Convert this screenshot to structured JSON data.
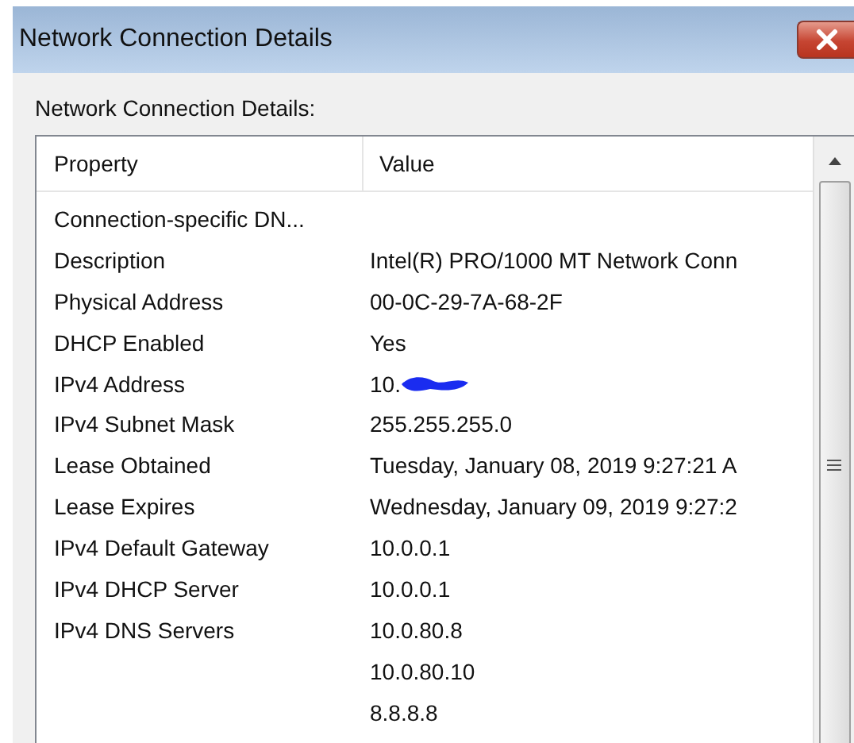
{
  "window": {
    "title": "Network Connection Details"
  },
  "label": "Network Connection Details:",
  "table": {
    "columns": [
      "Property",
      "Value"
    ],
    "rows": [
      {
        "property": "Connection-specific DN..."
      },
      {
        "property": "Description",
        "value": "Intel(R) PRO/1000 MT Network Conn"
      },
      {
        "property": "Physical Address",
        "value": "00-0C-29-7A-68-2F"
      },
      {
        "property": "DHCP Enabled",
        "value": "Yes"
      },
      {
        "property": "IPv4 Address",
        "value": "10.",
        "redacted": true
      },
      {
        "property": "IPv4 Subnet Mask",
        "value": "255.255.255.0"
      },
      {
        "property": "Lease Obtained",
        "value": "Tuesday, January 08, 2019 9:27:21 A"
      },
      {
        "property": "Lease Expires",
        "value": "Wednesday, January 09, 2019 9:27:2"
      },
      {
        "property": "IPv4 Default Gateway",
        "value": "10.0.0.1"
      },
      {
        "property": "IPv4 DHCP Server",
        "value": "10.0.0.1"
      },
      {
        "property": "IPv4 DNS Servers",
        "value": "10.0.80.8"
      },
      {
        "value": "10.0.80.10"
      },
      {
        "value": "8.8.8.8"
      }
    ]
  }
}
